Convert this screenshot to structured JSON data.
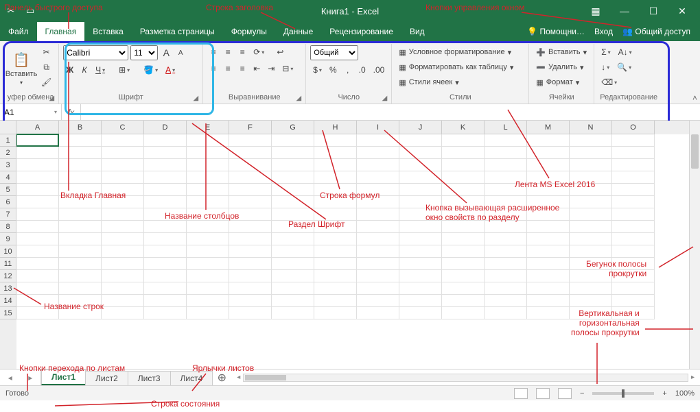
{
  "title": "Книга1 - Excel",
  "qat": {
    "tooltips": [
      "cut",
      "touch-mode",
      "customize"
    ]
  },
  "win": {
    "ribbonOpts": "▦",
    "min": "—",
    "max": "☐",
    "close": "✕"
  },
  "tabs": [
    "Файл",
    "Главная",
    "Вставка",
    "Разметка страницы",
    "Формулы",
    "Данные",
    "Рецензирование",
    "Вид"
  ],
  "activeTab": 1,
  "help": {
    "assist": "Помощни…",
    "signin": "Вход",
    "share": "Общий доступ"
  },
  "ribbon": {
    "clipboard": {
      "paste": "Вставить",
      "label": "уфер обмена"
    },
    "font": {
      "name": "Calibri",
      "size": "11",
      "bold": "Ж",
      "italic": "К",
      "underline": "Ч",
      "label": "Шрифт",
      "growA": "A",
      "shrinkA": "A"
    },
    "align": {
      "label": "Выравнивание"
    },
    "number": {
      "format": "Общий",
      "label": "Число"
    },
    "styles": {
      "cond": "Условное форматирование",
      "table": "Форматировать как таблицу",
      "cell": "Стили ячеек",
      "label": "Стили"
    },
    "cells": {
      "ins": "Вставить",
      "del": "Удалить",
      "fmt": "Формат",
      "label": "Ячейки"
    },
    "edit": {
      "label": "Редактирование"
    }
  },
  "namebox": "A1",
  "fxLabel": "fx",
  "columns": [
    "A",
    "B",
    "C",
    "D",
    "E",
    "F",
    "G",
    "H",
    "I",
    "J",
    "K",
    "L",
    "M",
    "N",
    "O"
  ],
  "rows": [
    "1",
    "2",
    "3",
    "4",
    "5",
    "6",
    "7",
    "8",
    "9",
    "10",
    "11",
    "12",
    "13",
    "14",
    "15"
  ],
  "sheets": [
    "Лист1",
    "Лист2",
    "Лист3",
    "Лист4"
  ],
  "activeSheet": 0,
  "addSheet": "⊕",
  "status": {
    "ready": "Готово",
    "zoom": "100%"
  },
  "ann": {
    "qat": "Панель быстрого доступа",
    "title": "Строка заголовка",
    "winctl": "Кнопки управления окном",
    "hometab": "Вкладка Главная",
    "cols": "Название столбцов",
    "fxbar": "Строка формул",
    "fontgrp": "Раздел Шрифт",
    "launcher": "Кнопка вызывающая расширенное\nокно свойств по разделу",
    "ribbon": "Лента MS Excel 2016",
    "rows": "Название строк",
    "sheetnav": "Кнопки перехода по листам",
    "sheettabs": "Ярлычки листов",
    "statusbar": "Строка состояния",
    "scrollthumb": "Бегунок полосы\nпрокрутки",
    "scrollbars": "Вертикальная и\nгоризонтальная\nполосы прокрутки"
  }
}
